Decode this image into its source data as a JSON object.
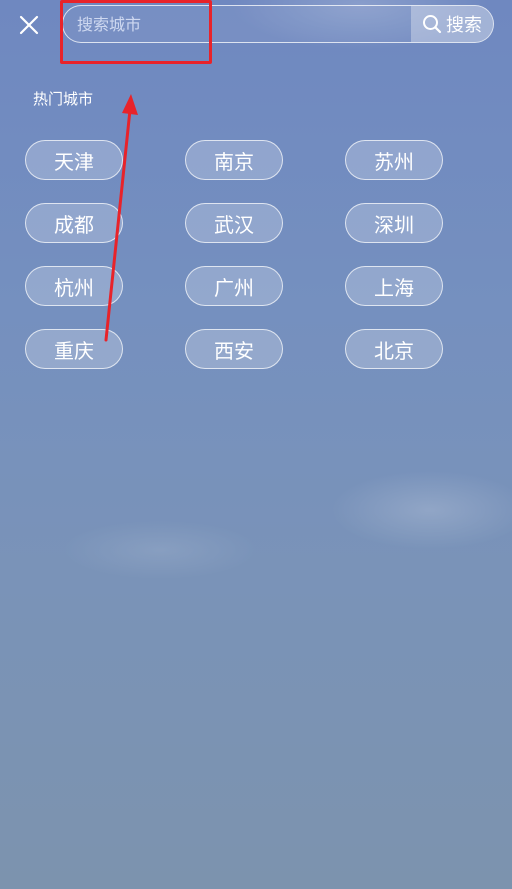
{
  "search": {
    "placeholder": "搜索城市",
    "button_label": "搜索"
  },
  "hot_cities": {
    "title": "热门城市",
    "items": [
      "天津",
      "南京",
      "苏州",
      "成都",
      "武汉",
      "深圳",
      "杭州",
      "广州",
      "上海",
      "重庆",
      "西安",
      "北京"
    ]
  },
  "annotation": {
    "color": "#e8232a"
  },
  "icons": {
    "close": "close-icon",
    "search": "search-icon",
    "arrow": "arrow-up-icon"
  }
}
